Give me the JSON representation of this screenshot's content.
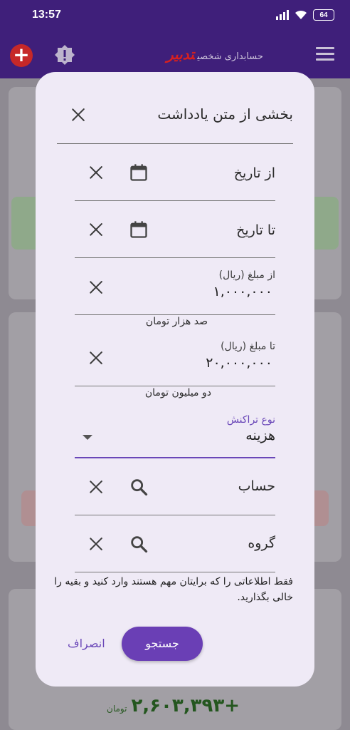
{
  "status": {
    "time": "13:57",
    "battery": "64"
  },
  "appbar": {
    "brand_logo": "تدبیر",
    "brand_text": "حسابداری شخصی",
    "add_icon": "plus-circle-icon",
    "alert_icon": "alert-badge-icon",
    "menu_icon": "hamburger-menu-icon"
  },
  "background": {
    "total_amount": "+۲,۶۰۳,۳۹۳",
    "total_unit": "تومان"
  },
  "dialog": {
    "title": "بخشی از متن یادداشت",
    "fields": {
      "from_date": {
        "label": "از تاریخ"
      },
      "to_date": {
        "label": "تا تاریخ"
      },
      "from_amount": {
        "label": "از مبلغ (ریال)",
        "value": "۱,۰۰۰,۰۰۰",
        "helper": "صد هزار تومان"
      },
      "to_amount": {
        "label": "تا مبلغ (ریال)",
        "value": "۲۰,۰۰۰,۰۰۰",
        "helper": "دو میلیون تومان"
      },
      "transaction_type": {
        "label": "نوع تراکنش",
        "value": "هزینه"
      },
      "account": {
        "label": "حساب"
      },
      "group": {
        "label": "گروه"
      }
    },
    "note": "فقط اطلاعاتی را که برایتان مهم هستند وارد کنید و بقیه را خالی بگذارید.",
    "search_button": "جستجو",
    "cancel_button": "انصراف"
  },
  "colors": {
    "appbar": "#3f1f7a",
    "accent": "#6a3fb5",
    "danger": "#c62828",
    "dialog_bg": "#efeaf6"
  }
}
